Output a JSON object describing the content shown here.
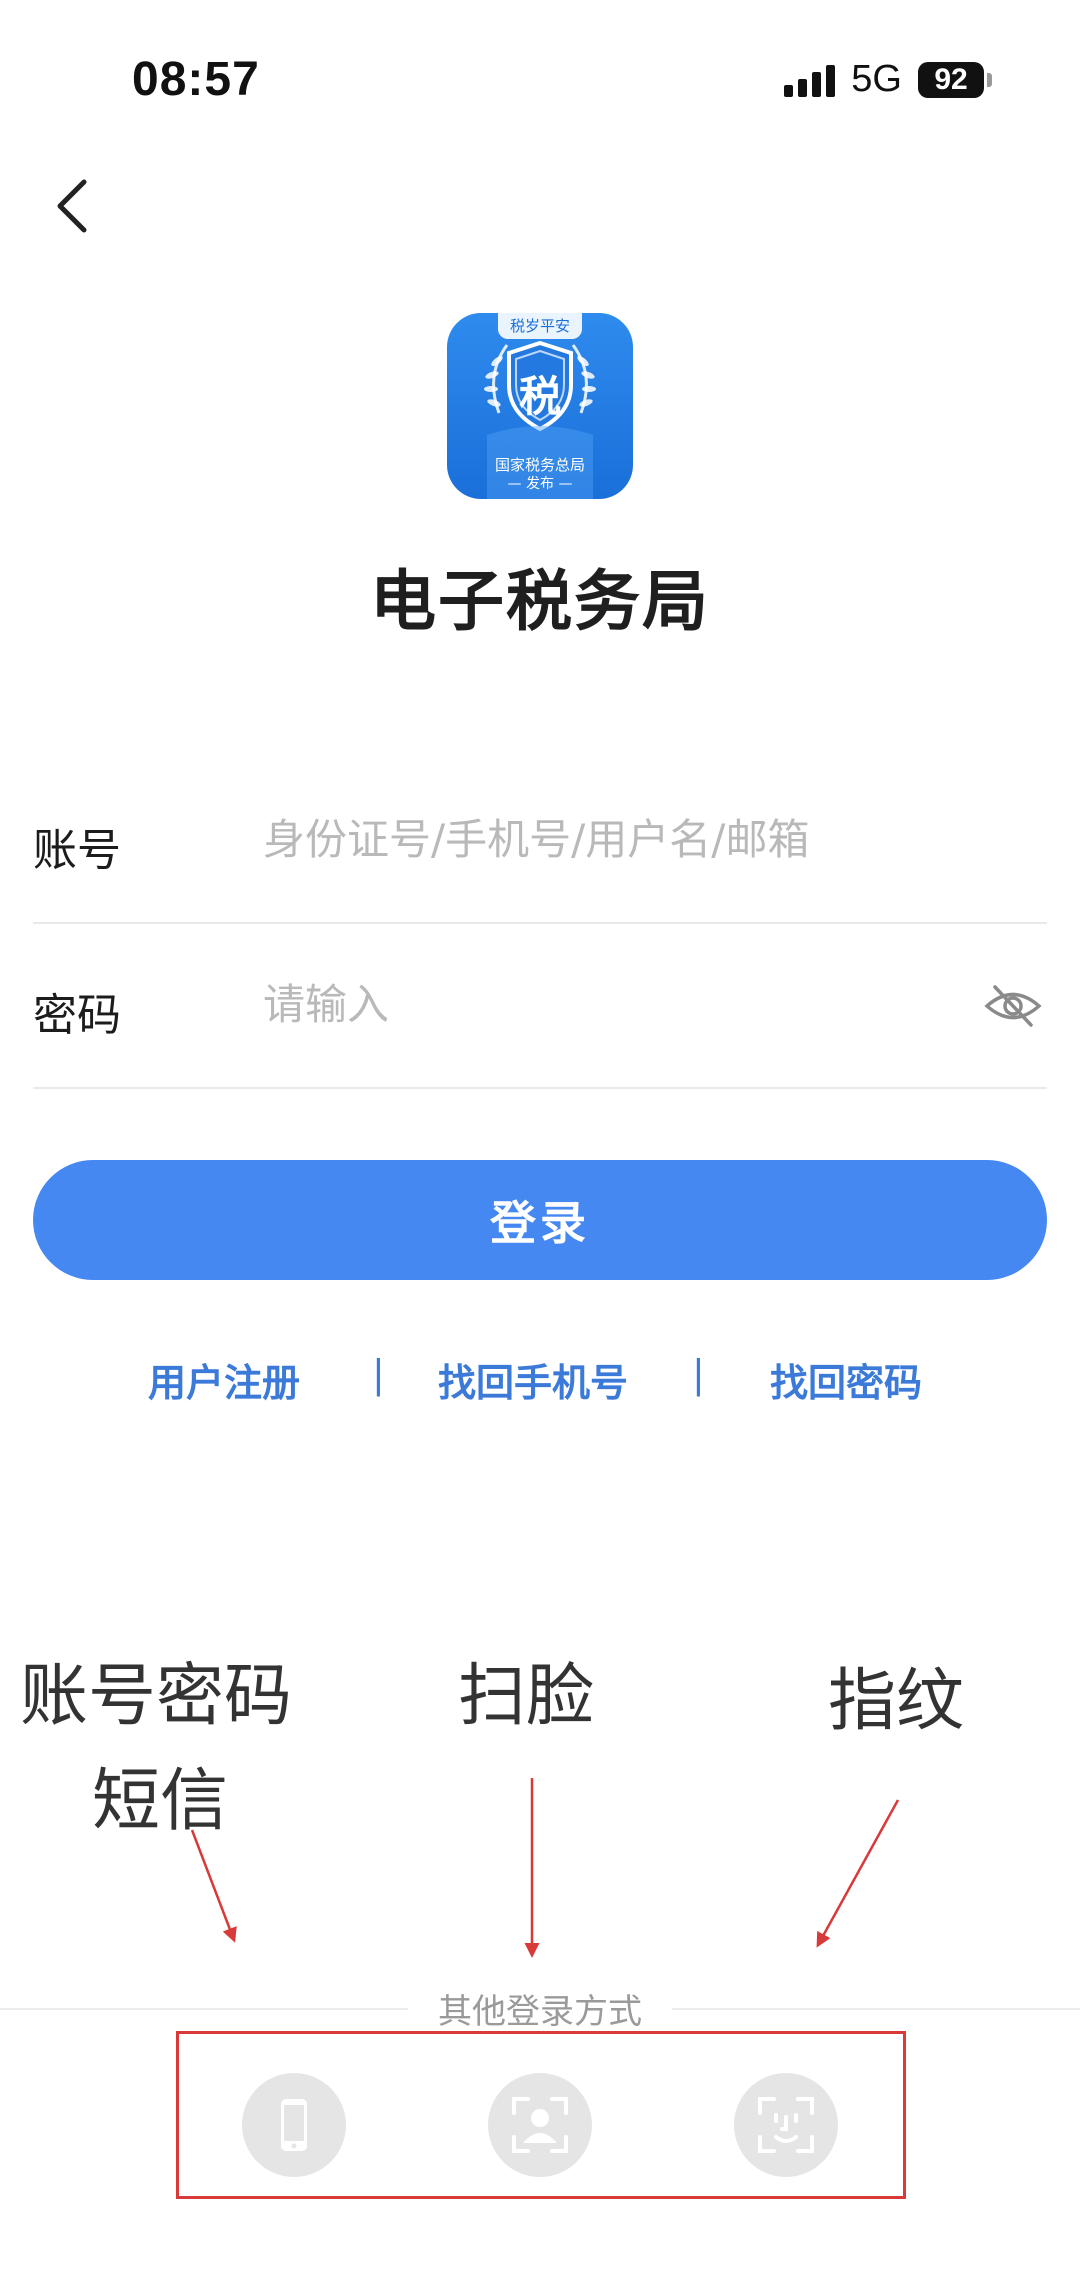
{
  "status_bar": {
    "time": "08:57",
    "network": "5G",
    "battery": "92"
  },
  "app": {
    "logo_tag": "税岁平安",
    "logo_char": "税",
    "logo_caption_line1": "国家税务总局",
    "logo_caption_line2": "— 发布 —",
    "title": "电子税务局"
  },
  "form": {
    "account_label": "账号",
    "account_placeholder": "身份证号/手机号/用户名/邮箱",
    "password_label": "密码",
    "password_placeholder": "请输入"
  },
  "login_button": "登录",
  "links": {
    "register": "用户注册",
    "separator": "|",
    "recover_phone": "找回手机号",
    "recover_password": "找回密码"
  },
  "annotations": {
    "account_password": "账号密码",
    "sms": "短信",
    "face_scan": "扫脸",
    "fingerprint": "指纹"
  },
  "other_login": {
    "label": "其他登录方式",
    "methods": [
      "phone-icon",
      "face-id-icon",
      "face-scan-icon"
    ]
  },
  "colors": {
    "primary": "#4688f1",
    "link": "#3b7ad8",
    "annotation_arrow": "#d83a3a"
  }
}
